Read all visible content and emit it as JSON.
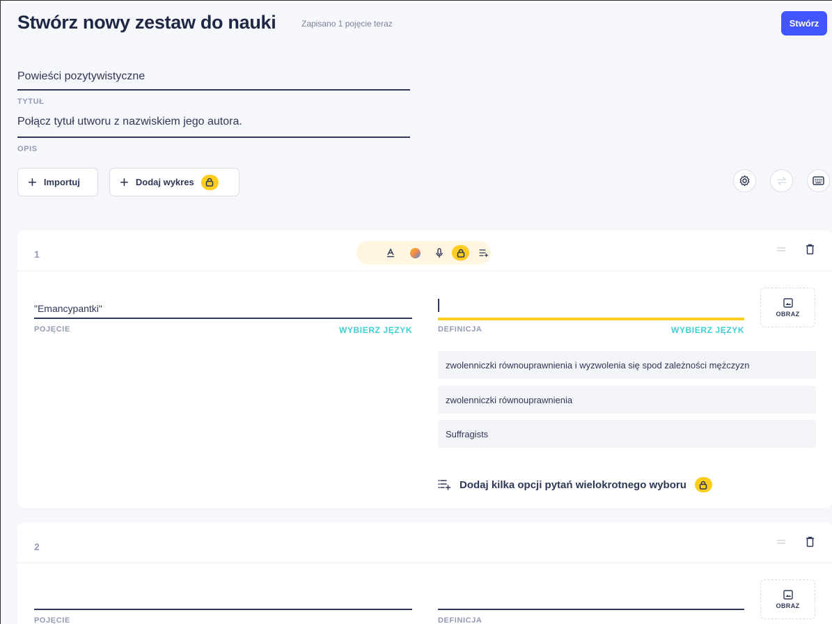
{
  "header": {
    "title": "Stwórz nowy zestaw do nauki",
    "save_status": "Zapisano 1 pojęcie teraz",
    "create_label": "Stwórz"
  },
  "set_title": {
    "value": "Powieści pozytywistyczne",
    "label": "TYTUŁ"
  },
  "set_description": {
    "value": "Połącz tytuł utworu z nazwiskiem jego autora.",
    "label": "OPIS"
  },
  "actions": {
    "import_label": "Importuj",
    "add_diagram_label": "Dodaj wykres"
  },
  "icons": {
    "settings": "gear-icon",
    "swap": "swap-icon",
    "keyboard": "keyboard-icon",
    "lock": "lock-icon",
    "drag": "drag-handle-icon",
    "delete": "trash-icon",
    "image": "image-icon"
  },
  "colors": {
    "primary": "#4255ff",
    "premium": "#ffcd1f",
    "language": "#3ccfcf",
    "active_field": "#ffcd1f"
  },
  "cards": [
    {
      "number": "1",
      "term_value": "\"Emancypantki\"",
      "term_label": "POJĘCIE",
      "term_lang": "WYBIERZ JĘZYK",
      "definition_value": "",
      "definition_label": "DEFINICJA",
      "definition_lang": "WYBIERZ JĘZYK",
      "image_label": "OBRAZ",
      "suggestions": [
        "zwolenniczki równouprawnienia i wyzwolenia się spod zależności mężczyzn",
        "zwolenniczki równouprawnienia",
        "Suffragists"
      ],
      "add_multiple_choice": "Dodaj kilka opcji pytań wielokrotnego wyboru"
    },
    {
      "number": "2",
      "term_value": "",
      "term_label": "POJĘCIE",
      "definition_value": "",
      "definition_label": "DEFINICJA",
      "image_label": "OBRAZ"
    }
  ]
}
